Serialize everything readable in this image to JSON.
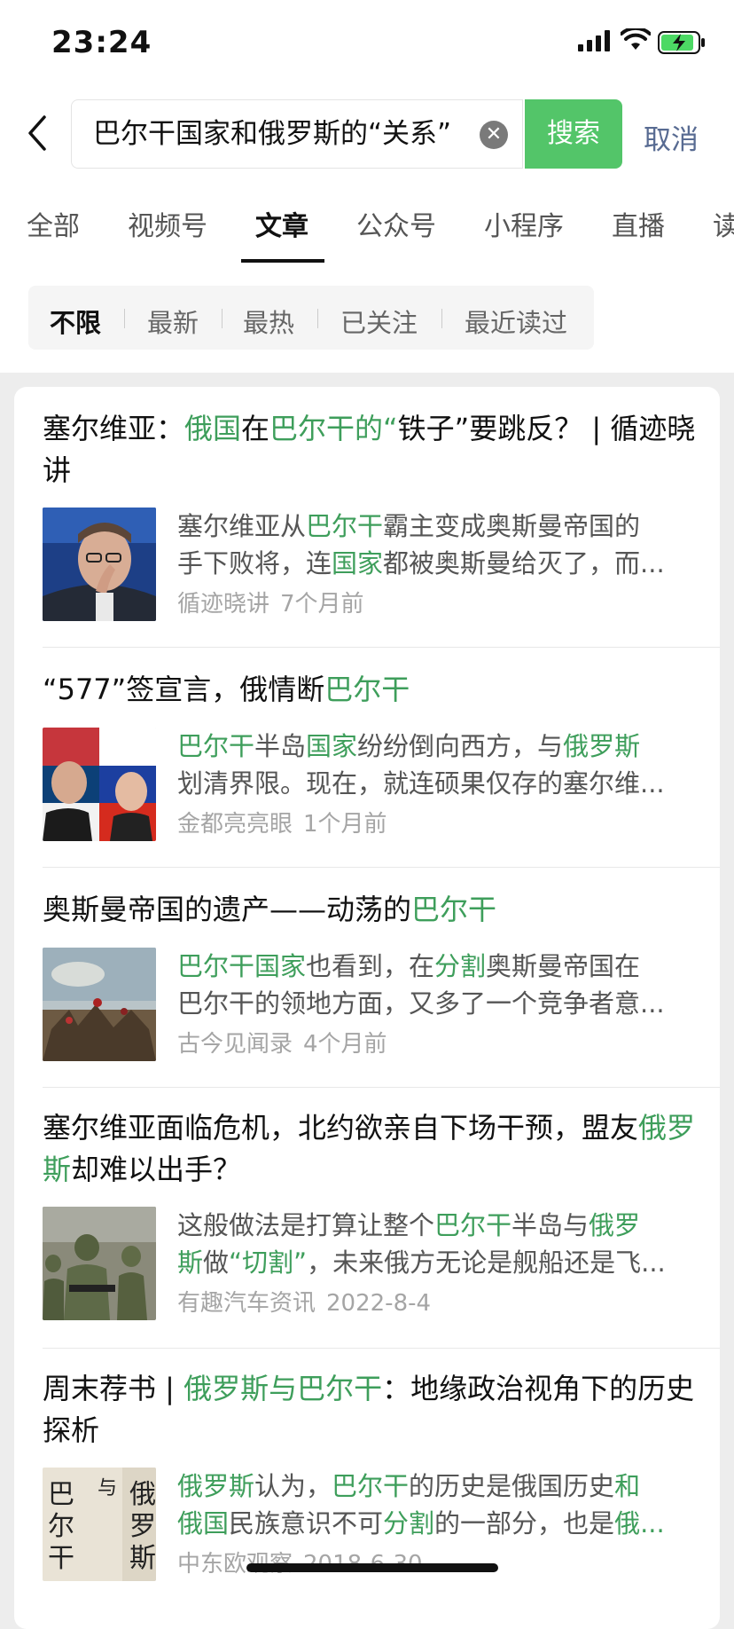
{
  "status_bar": {
    "time": "23:24"
  },
  "search": {
    "query": "巴尔干国家和俄罗斯的“关系”",
    "button_label": "搜索",
    "cancel_label": "取消"
  },
  "tabs": [
    "全部",
    "视频号",
    "文章",
    "公众号",
    "小程序",
    "直播",
    "读书"
  ],
  "filters": [
    "不限",
    "最新",
    "最热",
    "已关注",
    "最近读过"
  ],
  "accent_color": "#3e9e5b",
  "results": [
    {
      "title": [
        "塞尔维亚：",
        "俄国",
        "在",
        "巴尔干的“",
        "铁子”要跳反？ | 循迹晓讲"
      ],
      "desc1": [
        "塞尔维亚从",
        "巴尔干",
        "霸主变成奥斯曼帝国的"
      ],
      "desc2": [
        "手下败将，连",
        "国家",
        "都被奥斯曼给灭了，而..."
      ],
      "source": "循迹晓讲",
      "date": "7个月前"
    },
    {
      "title": [
        "“577”签宣言，俄情断",
        "巴尔干"
      ],
      "desc1": [
        "巴尔干",
        "半岛",
        "国家",
        "纷纷倒向西方，与",
        "俄罗斯"
      ],
      "desc2": [
        "划清界限。现在，就连硕果仅存的塞尔维..."
      ],
      "source": "金都亮亮眼",
      "date": "1个月前"
    },
    {
      "title": [
        "奥斯曼帝国的遗产——动荡的",
        "巴尔干"
      ],
      "desc1": [
        "巴尔干国家",
        "也看到，在",
        "分割",
        "奥斯曼帝国在"
      ],
      "desc2": [
        "巴尔干的领地方面，又多了一个竞争者意..."
      ],
      "source": "古今见闻录",
      "date": "4个月前"
    },
    {
      "title": [
        "塞尔维亚面临危机，北约欲亲自下场干预，盟友",
        "俄罗斯",
        "却难以出手？"
      ],
      "desc1": [
        "这般做法是打算让整个",
        "巴尔干",
        "半岛与",
        "俄罗"
      ],
      "desc2": [
        "斯",
        "做",
        "“切割”",
        "，未来俄方无论是舰船还是飞..."
      ],
      "source": "有趣汽车资讯",
      "date": "2022-8-4"
    },
    {
      "title": [
        "周末荐书 | ",
        "俄罗斯与巴尔干",
        "：地缘政治视角下的历史探析"
      ],
      "desc1": [
        "俄罗斯",
        "认为，",
        "巴尔干",
        "的历史是俄国历史",
        "和"
      ],
      "desc2": [
        "俄国",
        "民族意识不可",
        "分割",
        "的一部分，也是",
        "俄..."
      ],
      "source": "中东欧观察",
      "date": "2018-6-30",
      "book_cover_text": "巴尔干 与 俄罗斯"
    }
  ]
}
